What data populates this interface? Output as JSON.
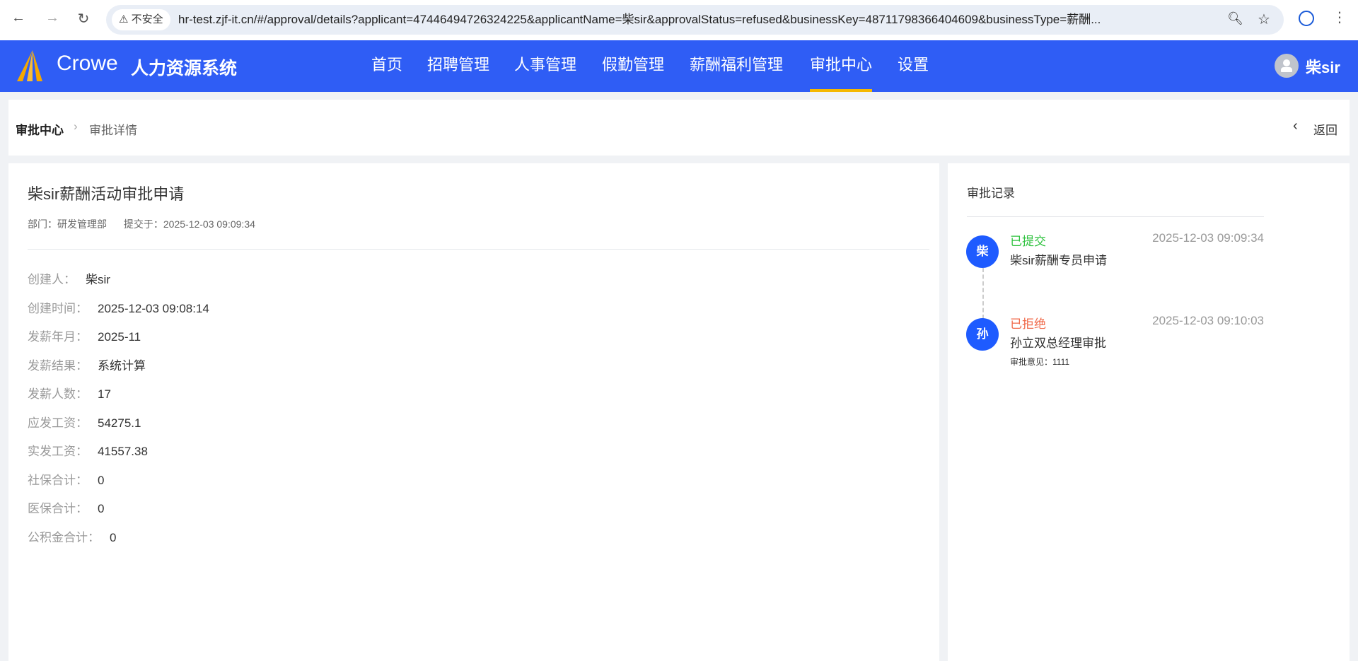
{
  "browser": {
    "security_label": "不安全",
    "url": "hr-test.zjf-it.cn/#/approval/details?applicant=47446494726324225&applicantName=柴sir&approvalStatus=refused&businessKey=48711798366404609&businessType=薪酬..."
  },
  "header": {
    "brand": "Crowe",
    "system_name": "人力资源系统",
    "nav": [
      "首页",
      "招聘管理",
      "人事管理",
      "假勤管理",
      "薪酬福利管理",
      "审批中心",
      "设置"
    ],
    "active_nav": "审批中心",
    "user": "柴sir",
    "accent": "#f5b800"
  },
  "breadcrumb": {
    "root": "审批中心",
    "current": "审批详情",
    "back": "返回"
  },
  "detail": {
    "title": "柴sir薪酬活动审批申请",
    "dept_label": "部门：",
    "dept": "研发管理部",
    "submit_label": "提交于：",
    "submit_time": "2025-12-03 09:09:34",
    "fields": [
      {
        "label": "创建人：",
        "value": "柴sir"
      },
      {
        "label": "创建时间：",
        "value": "2025-12-03 09:08:14"
      },
      {
        "label": "发薪年月：",
        "value": "2025-11"
      },
      {
        "label": "发薪结果：",
        "value": "系统计算"
      },
      {
        "label": "发薪人数：",
        "value": "17"
      },
      {
        "label": "应发工资：",
        "value": "54275.1"
      },
      {
        "label": "实发工资：",
        "value": "41557.38"
      },
      {
        "label": "社保合计：",
        "value": "0"
      },
      {
        "label": "医保合计：",
        "value": "0"
      },
      {
        "label": "公积金合计：",
        "value": "0"
      }
    ]
  },
  "records": {
    "title": "审批记录",
    "items": [
      {
        "avatar": "柴",
        "status": "已提交",
        "status_color": "#2ec23e",
        "time": "2025-12-03 09:09:34",
        "desc": "柴sir薪酬专员申请"
      },
      {
        "avatar": "孙",
        "status": "已拒绝",
        "status_color": "#f06a4a",
        "time": "2025-12-03 09:10:03",
        "desc": "孙立双总经理审批",
        "opinion": "审批意见：1111"
      }
    ]
  }
}
